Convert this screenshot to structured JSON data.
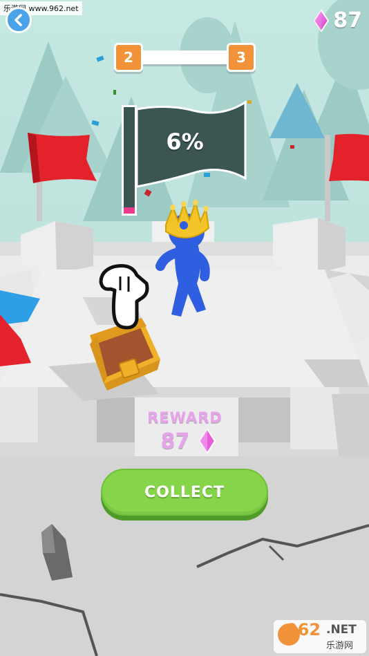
{
  "watermark": {
    "text": "乐游网 www.962.net"
  },
  "hud": {
    "back_icon": "chevron-left-icon",
    "gem_icon": "pink-diamond-icon",
    "gem_count": "87"
  },
  "level_progress": {
    "current_level": "2",
    "next_level": "3"
  },
  "flag": {
    "percent_text": "6%",
    "fill_fraction": 0.06
  },
  "reward": {
    "label": "REWARD",
    "amount": "87",
    "icon": "pink-diamond-icon"
  },
  "collect_button": {
    "label": "COLLECT"
  },
  "colors": {
    "sky": "#bfe3dc",
    "tree": "#9ccbc5",
    "level_box": "#f2933a",
    "flag_red": "#e3222b",
    "castle": "#e6e6e6",
    "button_green": "#86d44a",
    "gem_pink": "#e45fd8",
    "reward_text": "#e7a3ea",
    "character_blue": "#2f5fe0",
    "crown_gold": "#f2c42a",
    "chest_gold": "#f0b12a"
  },
  "logo": {
    "big": "962",
    "suffix": ".NET",
    "chinese": "乐游网"
  }
}
